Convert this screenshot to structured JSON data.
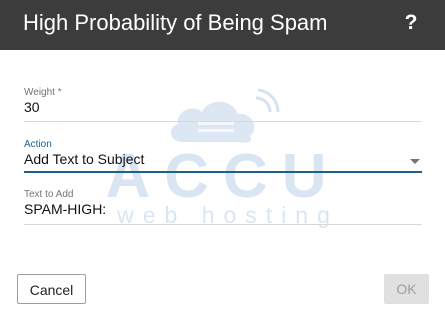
{
  "dialog": {
    "title": "High Probability of Being Spam",
    "help_label": "?"
  },
  "watermark": {
    "brand": "ACCU",
    "subtitle": "web hosting"
  },
  "form": {
    "weight": {
      "label": "Weight *",
      "value": "30"
    },
    "action": {
      "label": "Action",
      "value": "Add Text to Subject"
    },
    "text_to_add": {
      "label": "Text to Add",
      "value": "SPAM-HIGH:"
    }
  },
  "buttons": {
    "cancel": "Cancel",
    "ok": "OK"
  },
  "colors": {
    "titlebar": "#3c3c3c",
    "accent": "#1f5f8b",
    "disabled_button": "#e0e0e0"
  }
}
